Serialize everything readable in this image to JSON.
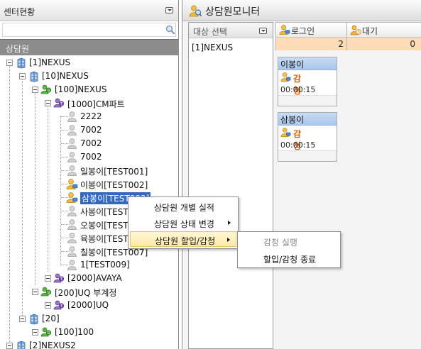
{
  "left": {
    "title": "센터현황",
    "search_placeholder": "",
    "section": "상담원"
  },
  "tree": [
    {
      "label": "[1]NEXUS",
      "icon": "building-icon"
    },
    {
      "label": "[10]NEXUS",
      "icon": "building-icon"
    },
    {
      "label": "[100]NEXUS",
      "icon": "group-icon"
    },
    {
      "label": "[1000]CM파트",
      "icon": "team-icon"
    },
    {
      "label": "2222",
      "icon": "agent-gray-icon"
    },
    {
      "label": "7002",
      "icon": "agent-gray-icon"
    },
    {
      "label": "7002",
      "icon": "agent-gray-icon"
    },
    {
      "label": "7002",
      "icon": "agent-gray-icon"
    },
    {
      "label": "일봉이[TEST001]",
      "icon": "agent-gray-icon"
    },
    {
      "label": "이봉이[TEST002]",
      "icon": "agent-monitor-icon"
    },
    {
      "label": "삼봉이[TEST003]",
      "icon": "agent-monitor-icon"
    },
    {
      "label": "사봉이[TEST004]",
      "icon": "agent-gray-icon"
    },
    {
      "label": "오봉이[TEST005]",
      "icon": "agent-gray-icon"
    },
    {
      "label": "육봉이[TEST006]",
      "icon": "agent-gray-icon"
    },
    {
      "label": "칠봉이[TEST007]",
      "icon": "agent-gray-icon"
    },
    {
      "label": "1[TEST009]",
      "icon": "agent-gray-icon"
    },
    {
      "label": "[2000]AVAYA",
      "icon": "team-icon"
    },
    {
      "label": "[200]UQ 부계정",
      "icon": "group-icon"
    },
    {
      "label": "[2000]UQ",
      "icon": "team-icon"
    },
    {
      "label": "[20]",
      "icon": "building-icon"
    },
    {
      "label": "[100]100",
      "icon": "group-icon"
    },
    {
      "label": "[2]NEXUS2",
      "icon": "building-icon"
    }
  ],
  "right": {
    "title": "상담원모니터",
    "target_header": "대상 선택",
    "target_item": "[1]NEXUS",
    "stats": [
      {
        "label": "로그인",
        "value": "2",
        "icon": "login-icon"
      },
      {
        "label": "대기",
        "value": "0",
        "icon": "wait-icon"
      }
    ],
    "cards": [
      {
        "name": "이봉이",
        "status": "감청",
        "time": "00:00:15",
        "icon": "agent-monitor-icon"
      },
      {
        "name": "삼봉이",
        "status": "감청",
        "time": "00:00:15",
        "icon": "agent-monitor-icon"
      }
    ]
  },
  "context_menu": {
    "items": [
      {
        "label": "상담원 개별 실적"
      },
      {
        "label": "상담원 상태 변경"
      },
      {
        "label": "상담원 할입/감청"
      }
    ]
  },
  "submenu": {
    "items": [
      {
        "label": "감청 실행",
        "disabled": true
      },
      {
        "label": "할입/감청 종료",
        "disabled": false
      }
    ]
  },
  "colors": {
    "selection": "#316ac5",
    "stat_value_bg": "#ffdcb7",
    "status_text": "#e25a00",
    "menu_highlight": "#ffe9a5",
    "section_bar": "#8c8c8c"
  }
}
